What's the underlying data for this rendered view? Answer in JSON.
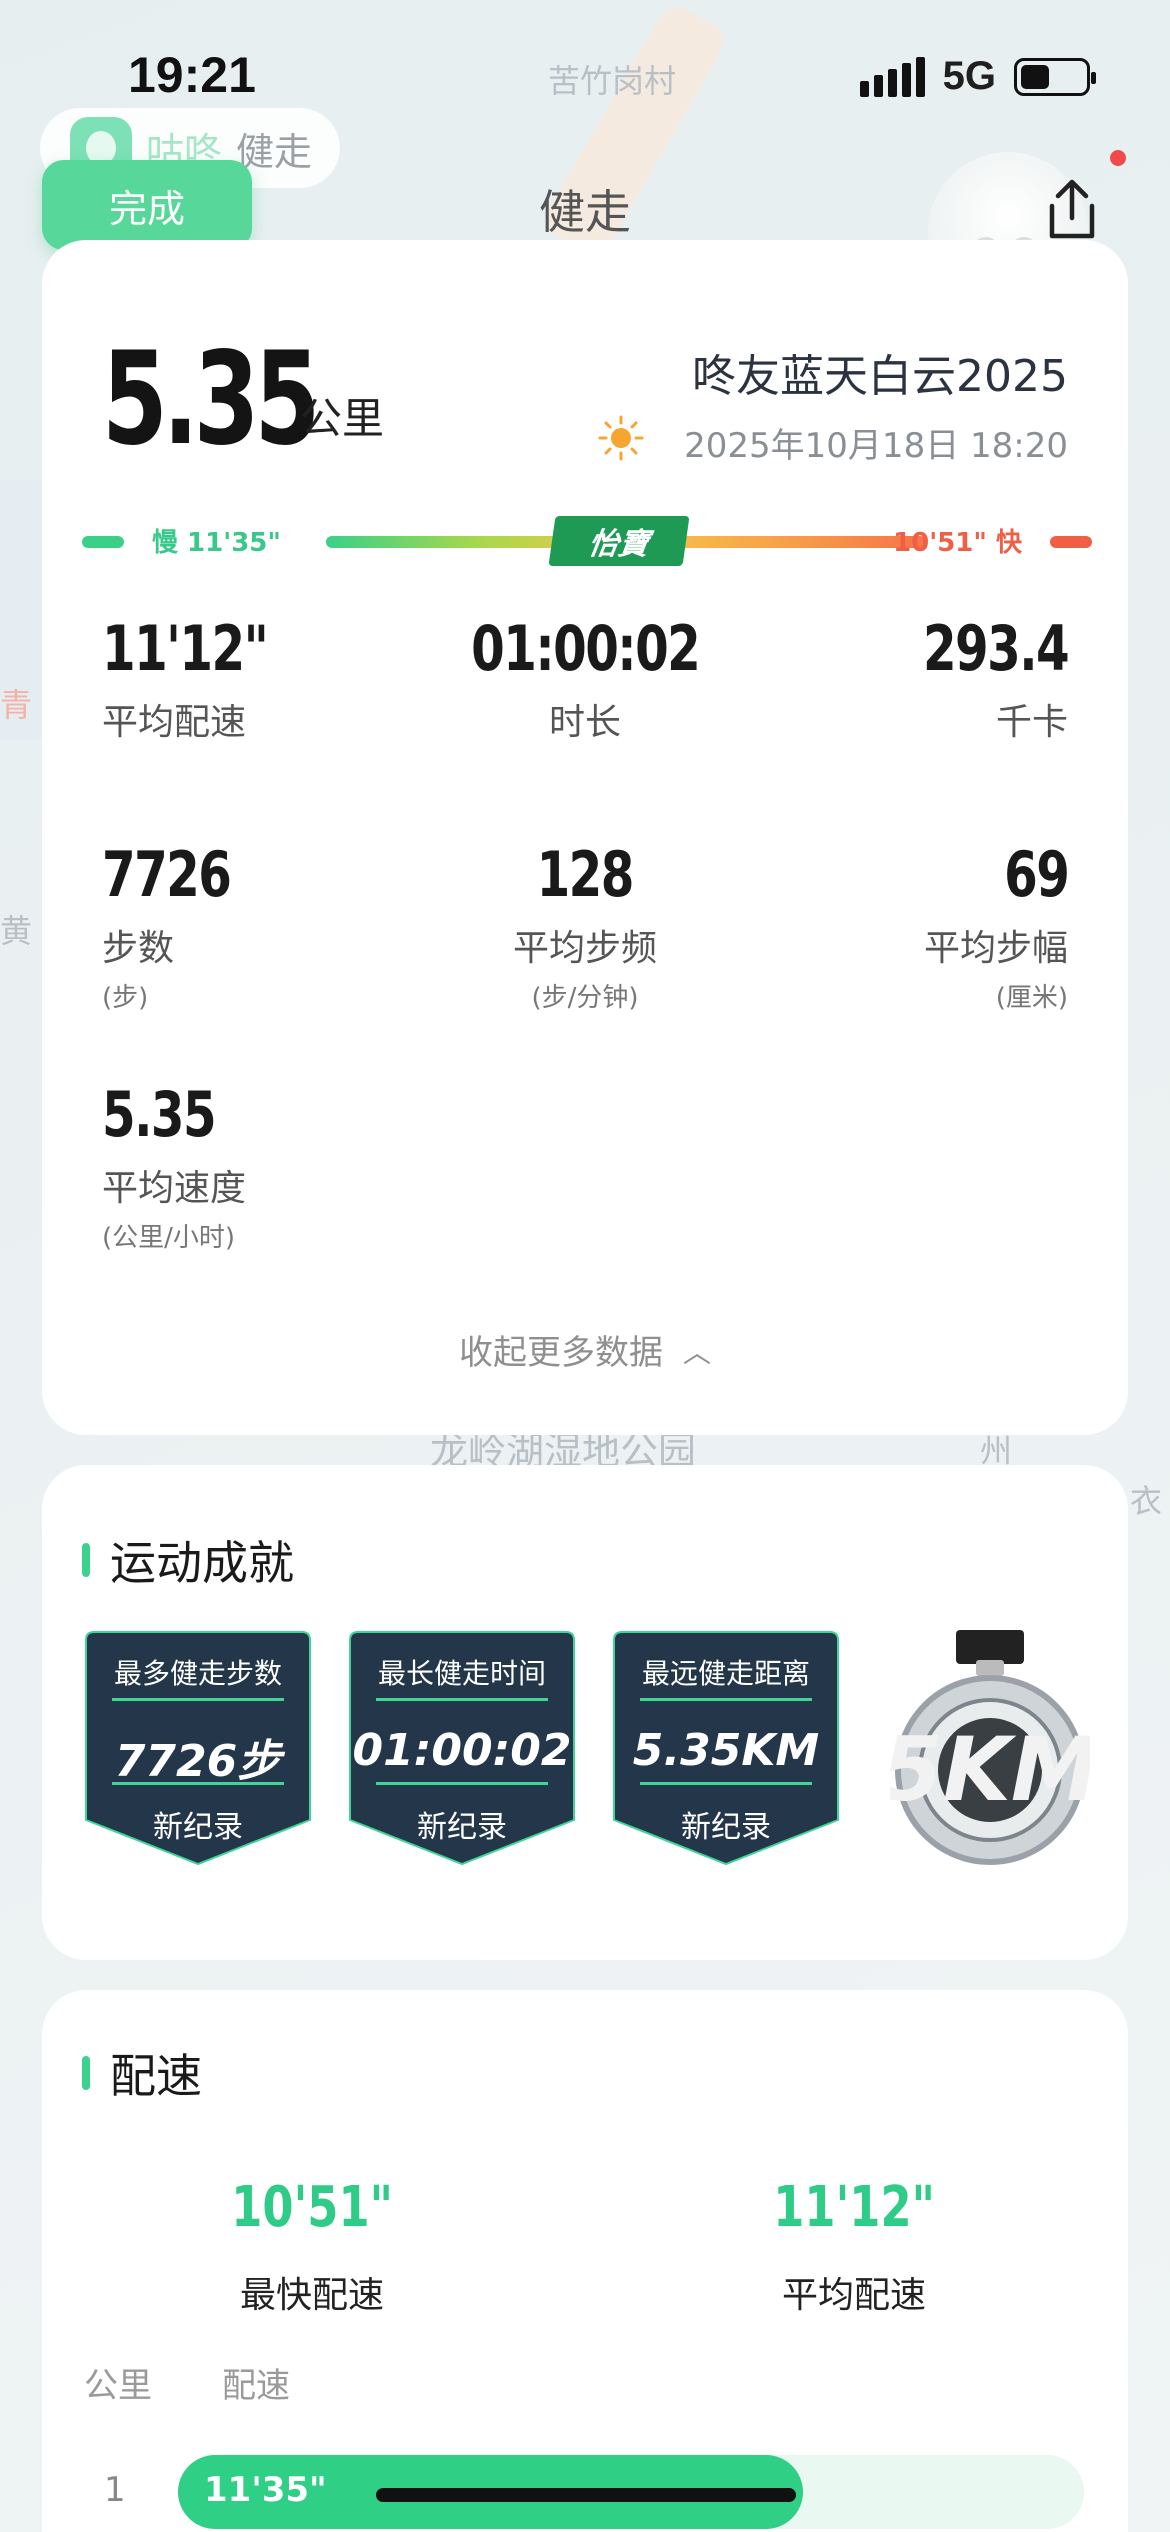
{
  "status": {
    "time": "19:21",
    "network": "5G"
  },
  "app": {
    "name": "咕咚",
    "sub": "健走",
    "done": "完成",
    "title": "健走"
  },
  "map_labels": [
    "苦竹岗村",
    "龙岭湖湿地公园",
    "州",
    "衣",
    "黄",
    "青"
  ],
  "summary": {
    "distance": "5.35",
    "distance_unit": "公里",
    "event": "咚友蓝天白云2025",
    "datetime": "2025年10月18日 18:20",
    "pace_slow": "慢 11'35\"",
    "pace_fast": "10'51\" 快",
    "sponsor": "怡寶",
    "collapse": "收起更多数据"
  },
  "stats": {
    "avg_pace": {
      "value": "11'12\"",
      "label": "平均配速"
    },
    "duration": {
      "value": "01:00:02",
      "label": "时长"
    },
    "calories": {
      "value": "293.4",
      "label": "千卡"
    },
    "steps": {
      "value": "7726",
      "label": "步数",
      "unit": "(步)"
    },
    "cadence": {
      "value": "128",
      "label": "平均步频",
      "unit": "(步/分钟)"
    },
    "stride": {
      "value": "69",
      "label": "平均步幅",
      "unit": "(厘米)"
    },
    "speed": {
      "value": "5.35",
      "label": "平均速度",
      "unit": "(公里/小时)"
    }
  },
  "achievements": {
    "title": "运动成就",
    "badges": [
      {
        "title": "最多健走步数",
        "value": "7726步",
        "record": "新纪录"
      },
      {
        "title": "最长健走时间",
        "value": "01:00:02",
        "record": "新纪录"
      },
      {
        "title": "最远健走距离",
        "value": "5.35KM",
        "record": "新纪录"
      }
    ],
    "medal_text": "5KM"
  },
  "pace": {
    "title": "配速",
    "fastest": {
      "value": "10'51\"",
      "label": "最快配速"
    },
    "average": {
      "value": "11'12\"",
      "label": "平均配速"
    },
    "col_km": "公里",
    "col_pace": "配速",
    "rows": [
      {
        "km": "1",
        "pace": "11'35\"",
        "fraction": 0.69
      }
    ]
  },
  "colors": {
    "accent": "#2fcf86",
    "fast": "#ef5f45",
    "badge_bg": "#23364a"
  }
}
